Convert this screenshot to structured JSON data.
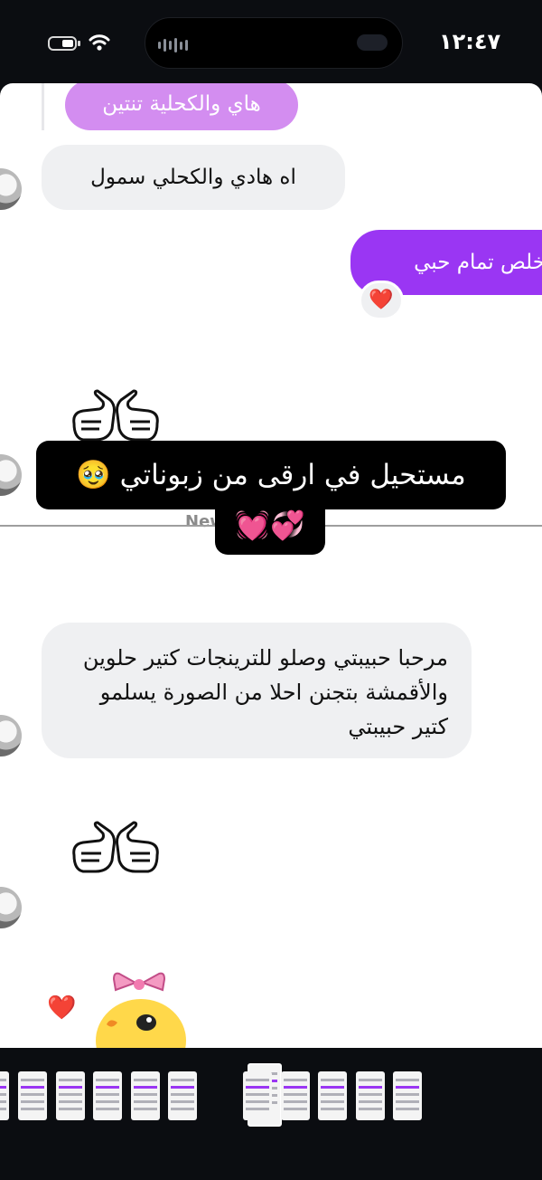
{
  "status_bar": {
    "time": "١٢:٤٧",
    "battery_level": 0.35
  },
  "chat": {
    "quoted_message": "هاي والكحلية تنتين",
    "incoming_1": "اه هادي والكحلي سمول",
    "outgoing_1": "خلص تمام حبي",
    "reaction_emoji": "❤️",
    "new_messages_label": "New messages",
    "incoming_2": "مرحبا حبيبتي وصلو للترينجات كتير حلوين والأقمشة بتجنن احلا من الصورة يسلمو كتير حبيبتي",
    "float_heart": "❤️"
  },
  "overlay_caption": {
    "line1": "مستحيل في ارقى من زبوناتي 🥹",
    "line2": "💞💓"
  },
  "thumbnails": {
    "count": 12,
    "selected_index": 6
  },
  "colors": {
    "outgoing": "#9a36f3",
    "quoted": "#d38df0",
    "incoming": "#eff0f2",
    "background": "#0b0d11"
  }
}
